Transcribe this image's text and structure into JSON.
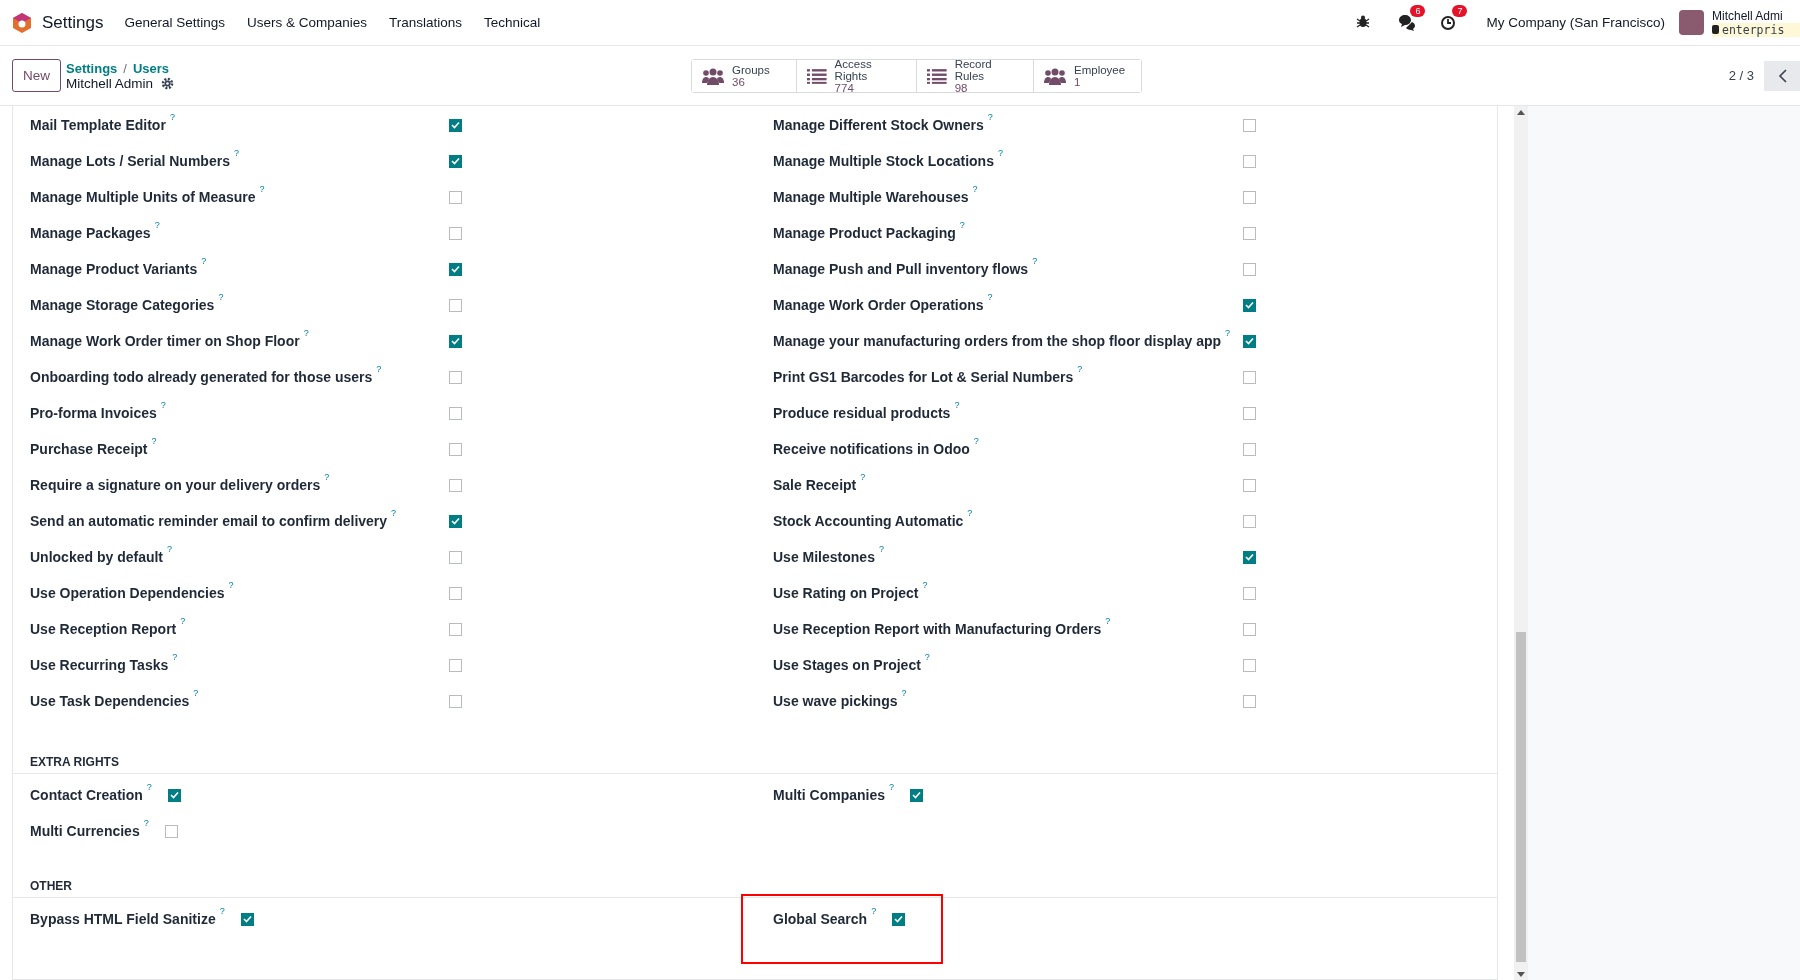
{
  "navbar": {
    "app_title": "Settings",
    "menu": [
      "General Settings",
      "Users & Companies",
      "Translations",
      "Technical"
    ],
    "systray": [
      {
        "kind": "bug"
      },
      {
        "kind": "chat",
        "badge": "6"
      },
      {
        "kind": "activity",
        "badge": "7"
      }
    ],
    "company": "My Company (San Francisco)",
    "user_name": "Mitchell Admi",
    "database": "enterpris"
  },
  "control_panel": {
    "new_button": "New",
    "breadcrumb": [
      "Settings",
      "Users"
    ],
    "breadcrumb_separator": "/",
    "record_name": "Mitchell Admin",
    "stat_buttons": [
      {
        "kind": "group",
        "label": "Groups",
        "value": "36"
      },
      {
        "kind": "list",
        "label": "Access Rights",
        "value": "774"
      },
      {
        "kind": "list",
        "label": "Record Rules",
        "value": "98"
      },
      {
        "kind": "group",
        "label": "Employee",
        "value": "1"
      }
    ],
    "pager": "2 / 3"
  },
  "sections": [
    {
      "kind": "wide",
      "items": [
        {
          "label": "Mail Template Editor",
          "hint": "?",
          "checked": true
        },
        {
          "label": "Manage Different Stock Owners",
          "hint": "?",
          "checked": false
        },
        {
          "label": "Manage Lots / Serial Numbers",
          "hint": "?",
          "checked": true
        },
        {
          "label": "Manage Multiple Stock Locations",
          "hint": "?",
          "checked": false
        },
        {
          "label": "Manage Multiple Units of Measure",
          "hint": "?",
          "checked": false
        },
        {
          "label": "Manage Multiple Warehouses",
          "hint": "?",
          "checked": false
        },
        {
          "label": "Manage Packages",
          "hint": "?",
          "checked": false
        },
        {
          "label": "Manage Product Packaging",
          "hint": "?",
          "checked": false
        },
        {
          "label": "Manage Product Variants",
          "hint": "?",
          "checked": true
        },
        {
          "label": "Manage Push and Pull inventory flows",
          "hint": "?",
          "checked": false
        },
        {
          "label": "Manage Storage Categories",
          "hint": "?",
          "checked": false
        },
        {
          "label": "Manage Work Order Operations",
          "hint": "?",
          "checked": true
        },
        {
          "label": "Manage Work Order timer on Shop Floor",
          "hint": "?",
          "checked": true
        },
        {
          "label": "Manage your manufacturing orders from the shop floor display app",
          "hint": "?",
          "checked": true
        },
        {
          "label": "Onboarding todo already generated for those users",
          "hint": "?",
          "checked": false
        },
        {
          "label": "Print GS1 Barcodes for Lot & Serial Numbers",
          "hint": "?",
          "checked": false
        },
        {
          "label": "Pro-forma Invoices",
          "hint": "?",
          "checked": false
        },
        {
          "label": "Produce residual products",
          "hint": "?",
          "checked": false
        },
        {
          "label": "Purchase Receipt",
          "hint": "?",
          "checked": false
        },
        {
          "label": "Receive notifications in Odoo",
          "hint": "?",
          "checked": false
        },
        {
          "label": "Require a signature on your delivery orders",
          "hint": "?",
          "checked": false
        },
        {
          "label": "Sale Receipt",
          "hint": "?",
          "checked": false
        },
        {
          "label": "Send an automatic reminder email to confirm delivery",
          "hint": "?",
          "checked": true
        },
        {
          "label": "Stock Accounting Automatic",
          "hint": "?",
          "checked": false
        },
        {
          "label": "Unlocked by default",
          "hint": "?",
          "checked": false
        },
        {
          "label": "Use Milestones",
          "hint": "?",
          "checked": true
        },
        {
          "label": "Use Operation Dependencies",
          "hint": "?",
          "checked": false
        },
        {
          "label": "Use Rating on Project",
          "hint": "?",
          "checked": false
        },
        {
          "label": "Use Reception Report",
          "hint": "?",
          "checked": false
        },
        {
          "label": "Use Reception Report with Manufacturing Orders",
          "hint": "?",
          "checked": false
        },
        {
          "label": "Use Recurring Tasks",
          "hint": "?",
          "checked": false
        },
        {
          "label": "Use Stages on Project",
          "hint": "?",
          "checked": false
        },
        {
          "label": "Use Task Dependencies",
          "hint": "?",
          "checked": false
        },
        {
          "label": "Use wave pickings",
          "hint": "?",
          "checked": false
        }
      ]
    },
    {
      "kind": "compact",
      "title": "EXTRA RIGHTS",
      "items": [
        {
          "label": "Contact Creation",
          "hint": "?",
          "checked": true
        },
        {
          "label": "Multi Companies",
          "hint": "?",
          "checked": true
        },
        {
          "label": "Multi Currencies",
          "hint": "?",
          "checked": false
        }
      ]
    },
    {
      "kind": "compact",
      "title": "OTHER",
      "items": [
        {
          "label": "Bypass HTML Field Sanitize",
          "hint": "?",
          "checked": true,
          "highlighted": false
        },
        {
          "label": "Global Search",
          "hint": "?",
          "checked": true,
          "highlighted": true
        }
      ]
    }
  ]
}
